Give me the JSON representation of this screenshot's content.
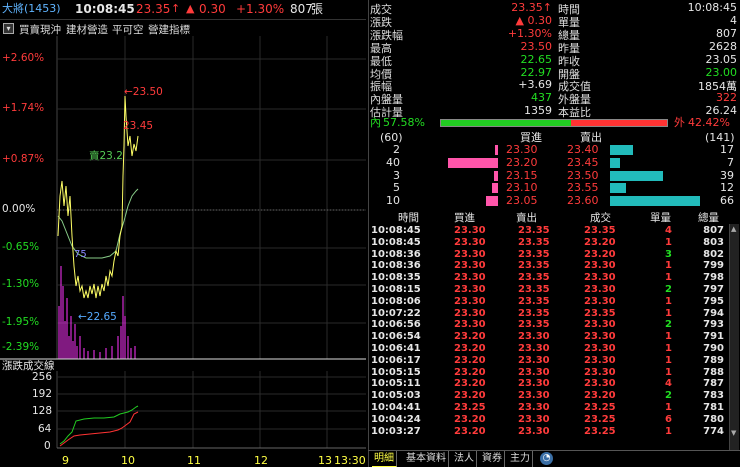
{
  "header": {
    "name": "大將(1453)",
    "time": "10:08:45",
    "price": "23.35",
    "arrow": "↑",
    "chg_arrow": "▲",
    "change": "0.30",
    "pct": "+1.30%",
    "volume": "807",
    "unit": "張"
  },
  "toolbar": {
    "items": [
      "買賣現沖",
      "建材營造",
      "平可空",
      "營建指標"
    ]
  },
  "chart": {
    "pct_labels": [
      "+2.60%",
      "+1.74%",
      "+0.87%",
      "0.00%",
      "-0.65%",
      "-1.30%",
      "-1.95%",
      "-2.39%"
    ],
    "annotations": {
      "high": "←23.50",
      "mid": "23.45",
      "avg": "賣23.2",
      "flag": "75",
      "low": "←22.65"
    },
    "vol_title": "漲跌成交線",
    "vol_labels": [
      "256",
      "192",
      "128",
      "64",
      "0"
    ],
    "x_labels": [
      "9",
      "10",
      "11",
      "12",
      "13",
      "13:30"
    ]
  },
  "quote": {
    "left": [
      [
        "成交",
        "23.35↑"
      ],
      [
        "漲跌",
        "▲ 0.30"
      ],
      [
        "漲跌幅",
        "+1.30%"
      ],
      [
        "最高",
        "23.50"
      ],
      [
        "最低",
        "22.65"
      ],
      [
        "均價",
        "22.97"
      ],
      [
        "振幅",
        "+3.69"
      ],
      [
        "內盤量",
        "437"
      ],
      [
        "估計量",
        "1359"
      ]
    ],
    "right": [
      [
        "時間",
        "10:08:45"
      ],
      [
        "單量",
        "4"
      ],
      [
        "總量",
        "807"
      ],
      [
        "昨量",
        "2628"
      ],
      [
        "昨收",
        "23.05"
      ],
      [
        "開盤",
        "23.00"
      ],
      [
        "成交值",
        "1854萬"
      ],
      [
        "外盤量",
        "322"
      ],
      [
        "本益比",
        "26.24"
      ]
    ]
  },
  "ratio": {
    "in_label": "內",
    "in_pct": "57.58%",
    "out_label": "外",
    "out_pct": "42.42%",
    "in_value": 57.58
  },
  "orderbook": {
    "bid_count": "(60)",
    "ask_count": "(141)",
    "bid_hdr": "買進",
    "ask_hdr": "賣出",
    "rows": [
      {
        "bq": "2",
        "bp": "23.30",
        "ap": "23.40",
        "aq": "17"
      },
      {
        "bq": "40",
        "bp": "23.20",
        "ap": "23.45",
        "aq": "7"
      },
      {
        "bq": "3",
        "bp": "23.15",
        "ap": "23.50",
        "aq": "39"
      },
      {
        "bq": "5",
        "bp": "23.10",
        "ap": "23.55",
        "aq": "12"
      },
      {
        "bq": "10",
        "bp": "23.05",
        "ap": "23.60",
        "aq": "66"
      }
    ]
  },
  "details": {
    "headers": [
      "時間",
      "買進",
      "賣出",
      "成交",
      "單量",
      "總量"
    ],
    "rows": [
      [
        "10:08:45",
        "23.30",
        "23.35",
        "23.35",
        "4",
        "807"
      ],
      [
        "10:08:45",
        "23.30",
        "23.35",
        "23.20",
        "1",
        "803"
      ],
      [
        "10:08:36",
        "23.30",
        "23.35",
        "23.20",
        "3",
        "802"
      ],
      [
        "10:08:36",
        "23.30",
        "23.35",
        "23.30",
        "1",
        "799"
      ],
      [
        "10:08:35",
        "23.30",
        "23.35",
        "23.30",
        "1",
        "798"
      ],
      [
        "10:08:15",
        "23.30",
        "23.35",
        "23.30",
        "2",
        "797"
      ],
      [
        "10:08:06",
        "23.30",
        "23.35",
        "23.30",
        "1",
        "795"
      ],
      [
        "10:07:22",
        "23.30",
        "23.35",
        "23.35",
        "1",
        "794"
      ],
      [
        "10:06:56",
        "23.30",
        "23.35",
        "23.30",
        "2",
        "793"
      ],
      [
        "10:06:54",
        "23.20",
        "23.30",
        "23.30",
        "1",
        "791"
      ],
      [
        "10:06:41",
        "23.20",
        "23.30",
        "23.30",
        "1",
        "790"
      ],
      [
        "10:06:17",
        "23.20",
        "23.30",
        "23.30",
        "1",
        "789"
      ],
      [
        "10:05:15",
        "23.20",
        "23.30",
        "23.30",
        "1",
        "788"
      ],
      [
        "10:05:11",
        "23.20",
        "23.30",
        "23.30",
        "4",
        "787"
      ],
      [
        "10:05:03",
        "23.20",
        "23.30",
        "23.20",
        "2",
        "783"
      ],
      [
        "10:04:41",
        "23.25",
        "23.30",
        "23.25",
        "1",
        "781"
      ],
      [
        "10:04:24",
        "23.20",
        "23.30",
        "23.25",
        "6",
        "780"
      ],
      [
        "10:03:27",
        "23.20",
        "23.30",
        "23.25",
        "1",
        "774"
      ]
    ]
  },
  "tabs": [
    "明細",
    "基本資料",
    "法人",
    "資券",
    "主力"
  ]
}
